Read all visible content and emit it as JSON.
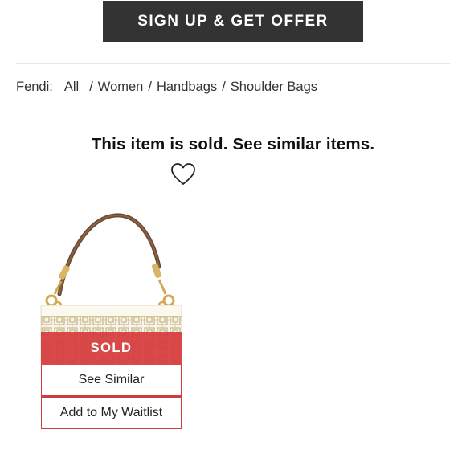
{
  "promo": {
    "cta_label": "SIGN UP & GET OFFER"
  },
  "breadcrumb": {
    "brand_prefix": "Fendi:",
    "links": [
      "All",
      "Women",
      "Handbags",
      "Shoulder Bags"
    ],
    "separator": "/"
  },
  "status": {
    "message": "This item is sold. See similar items."
  },
  "icons": {
    "favorite": "heart-outline-icon"
  },
  "product_card": {
    "badge": "SOLD",
    "see_similar_label": "See Similar",
    "waitlist_label": "Add to My Waitlist"
  },
  "colors": {
    "cta_background": "#333333",
    "sold_red": "#d63c3e",
    "text": "#222222"
  }
}
